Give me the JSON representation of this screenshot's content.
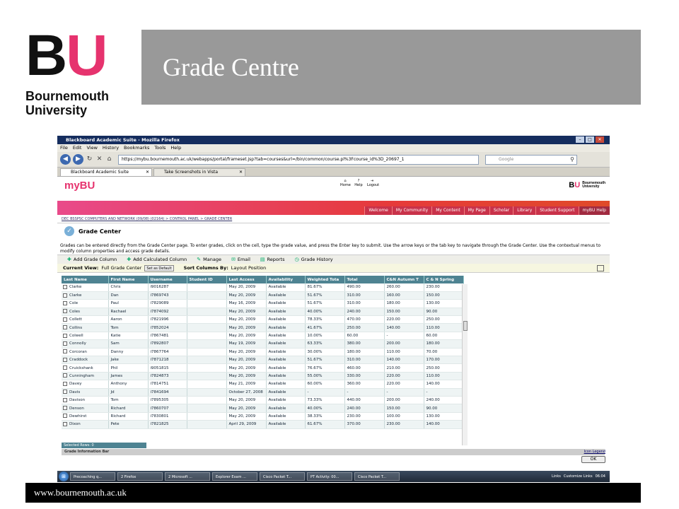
{
  "slide": {
    "title": "Grade Centre",
    "footer_url": "www.bournemouth.ac.uk"
  },
  "logo": {
    "letter_b": "B",
    "letter_u": "U",
    "name_line1": "Bournemouth",
    "name_line2": "University"
  },
  "browser": {
    "window_title": "Blackboard Academic Suite - Mozilla Firefox",
    "menu": [
      "File",
      "Edit",
      "View",
      "History",
      "Bookmarks",
      "Tools",
      "Help"
    ],
    "url": "https://mybu.bournemouth.ac.uk/webapps/portal/frameset.jsp?tab=courses&url=/bin/common/course.pl%3Fcourse_id%3D_20697_1",
    "search_placeholder": "Google",
    "tabs": [
      "Blackboard Academic Suite",
      "Take Screenshots in Vista"
    ]
  },
  "mybu": {
    "logo": "myBU",
    "header_icons": [
      "Home",
      "Help",
      "Logout"
    ],
    "nav": [
      "Welcome",
      "My Community",
      "My Content",
      "My Page",
      "Scholar",
      "Library",
      "Student Support",
      "myBU Help"
    ],
    "breadcrumb": "DEC BSSPSC COMPUTERS AND NETWORK (09/08) (02164) > CONTROL PANEL > GRADE CENTER",
    "page_title": "Grade Center",
    "instructions": "Grades can be entered directly from the Grade Center page. To enter grades, click on the cell, type the grade value, and press the Enter key to submit. Use the arrow keys or the tab key to navigate through the Grade Center. Use the contextual menus to modify column properties and access grade details.",
    "actions": [
      "Add Grade Column",
      "Add Calculated Column",
      "Manage",
      "Email",
      "Reports",
      "Grade History"
    ],
    "current_view_label": "Current View:",
    "current_view_value": "Full Grade Center",
    "set_default": "Set as Default",
    "sort_label": "Sort Columns By:",
    "sort_value": "Layout Position"
  },
  "grid": {
    "columns": [
      "Last Name",
      "First Name",
      "Username",
      "Student ID",
      "Last Access",
      "Availability",
      "Weighted Tota",
      "Total",
      "C&N Autumn T",
      "C & N Spring"
    ],
    "rows": [
      [
        "Clarke",
        "Chris",
        "i9016287",
        "",
        "May 20, 2009",
        "Available",
        "81.67%",
        "490.00",
        "260.00",
        "230.00"
      ],
      [
        "Clarke",
        "Dan",
        "i7869743",
        "",
        "May 20, 2009",
        "Available",
        "51.67%",
        "310.00",
        "160.00",
        "150.00"
      ],
      [
        "Cole",
        "Paul",
        "i7829089",
        "",
        "May 16, 2009",
        "Available",
        "51.67%",
        "310.00",
        "180.00",
        "130.00"
      ],
      [
        "Coles",
        "Rachael",
        "i7874092",
        "",
        "May 20, 2009",
        "Available",
        "40.00%",
        "240.00",
        "150.00",
        "90.00"
      ],
      [
        "Collett",
        "Aaron",
        "i7821996",
        "",
        "May 20, 2009",
        "Available",
        "78.33%",
        "470.00",
        "220.00",
        "250.00"
      ],
      [
        "Collins",
        "Tom",
        "i7852024",
        "",
        "May 20, 2009",
        "Available",
        "41.67%",
        "250.00",
        "140.00",
        "110.00"
      ],
      [
        "Colwell",
        "Katie",
        "i7867481",
        "",
        "May 20, 2009",
        "Available",
        "10.00%",
        "60.00",
        "-",
        "60.00"
      ],
      [
        "Connolly",
        "Sam",
        "i7892807",
        "",
        "May 19, 2009",
        "Available",
        "63.33%",
        "380.00",
        "200.00",
        "180.00"
      ],
      [
        "Corcoran",
        "Danny",
        "i7867764",
        "",
        "May 20, 2009",
        "Available",
        "30.00%",
        "180.00",
        "110.00",
        "70.00"
      ],
      [
        "Craddock",
        "Jake",
        "i7871218",
        "",
        "May 20, 2009",
        "Available",
        "51.67%",
        "310.00",
        "140.00",
        "170.00"
      ],
      [
        "Cruickshank",
        "Phil",
        "i9051815",
        "",
        "May 20, 2009",
        "Available",
        "76.67%",
        "460.00",
        "210.00",
        "250.00"
      ],
      [
        "Cunningham",
        "James",
        "i7824873",
        "",
        "May 20, 2009",
        "Available",
        "55.00%",
        "330.00",
        "220.00",
        "110.00"
      ],
      [
        "Davey",
        "Anthony",
        "i7814751",
        "",
        "May 21, 2009",
        "Available",
        "60.00%",
        "360.00",
        "220.00",
        "140.00"
      ],
      [
        "Davis",
        "Jd",
        "i7841694",
        "",
        "October 27, 2008",
        "Available",
        "-",
        "-",
        "-",
        "-"
      ],
      [
        "Davison",
        "Tom",
        "i7895305",
        "",
        "May 20, 2009",
        "Available",
        "73.33%",
        "440.00",
        "200.00",
        "240.00"
      ],
      [
        "Denson",
        "Richard",
        "i7860707",
        "",
        "May 20, 2009",
        "Available",
        "40.00%",
        "240.00",
        "150.00",
        "90.00"
      ],
      [
        "Dewhirst",
        "Richard",
        "i7830801",
        "",
        "May 20, 2009",
        "Available",
        "38.33%",
        "230.00",
        "100.00",
        "130.00"
      ],
      [
        "Dixon",
        "Pete",
        "i7821825",
        "",
        "April 29, 2009",
        "Available",
        "61.67%",
        "370.00",
        "230.00",
        "140.00"
      ]
    ],
    "selected_rows": "Selected Rows: 0",
    "info_bar": "Grade Information Bar",
    "icon_legend": "Icon Legend",
    "ok": "OK"
  },
  "taskbar": {
    "items": [
      "Precoaching q...",
      "2 Firefox",
      "2 Microsoft ...",
      "Explorer Exam ...",
      "Cisco Packet T...",
      "PT Activity: 00...",
      "Cisco Packet T..."
    ],
    "links": "Links",
    "customize": "Customize Links",
    "time": "06:04"
  }
}
